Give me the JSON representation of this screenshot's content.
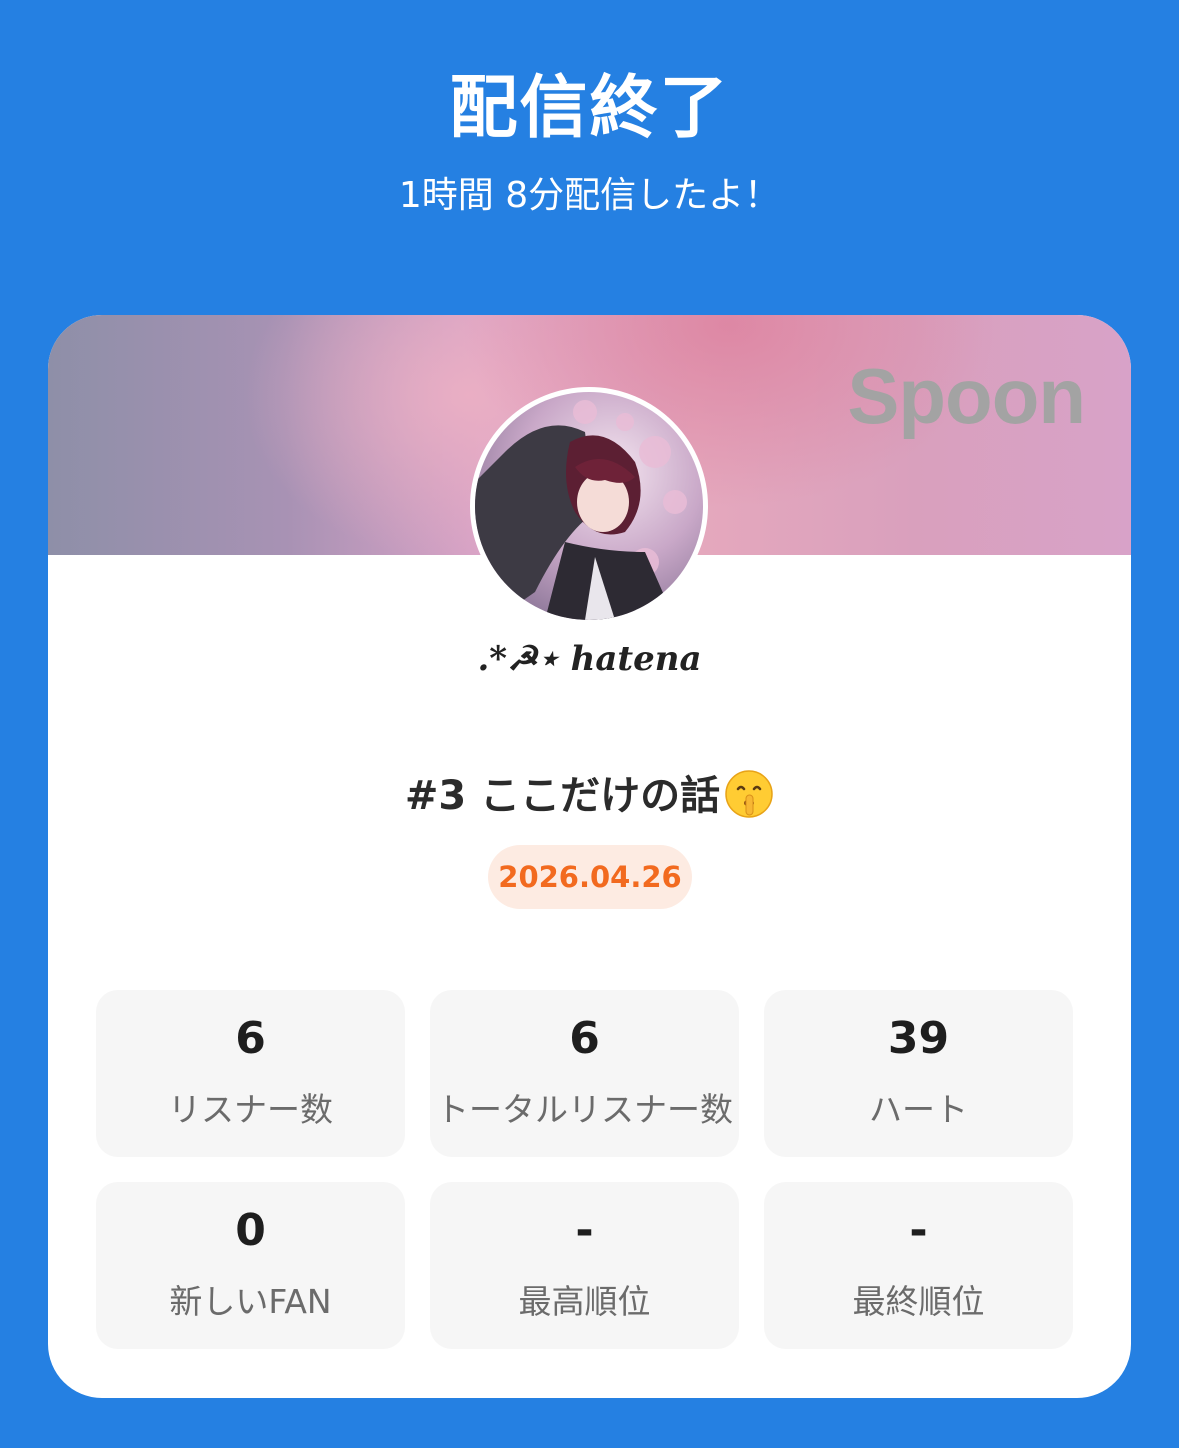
{
  "header": {
    "title": "配信終了",
    "subtitle": "1時間 8分配信したよ！"
  },
  "card": {
    "brand": "Spoon",
    "username": ".*☭⋆ hatena",
    "stream_title": "#3 ここだけの話",
    "stream_title_emoji": "shushing-face-icon",
    "date": "2026.04.26",
    "colors": {
      "date_text": "#f26a1f",
      "date_bg": "#fdebe2",
      "background": "#2580e2"
    }
  },
  "stats": [
    {
      "value": "6",
      "label": "リスナー数"
    },
    {
      "value": "6",
      "label": "トータルリスナー数"
    },
    {
      "value": "39",
      "label": "ハート"
    },
    {
      "value": "0",
      "label": "新しいFAN"
    },
    {
      "value": "-",
      "label": "最高順位"
    },
    {
      "value": "-",
      "label": "最終順位"
    }
  ]
}
